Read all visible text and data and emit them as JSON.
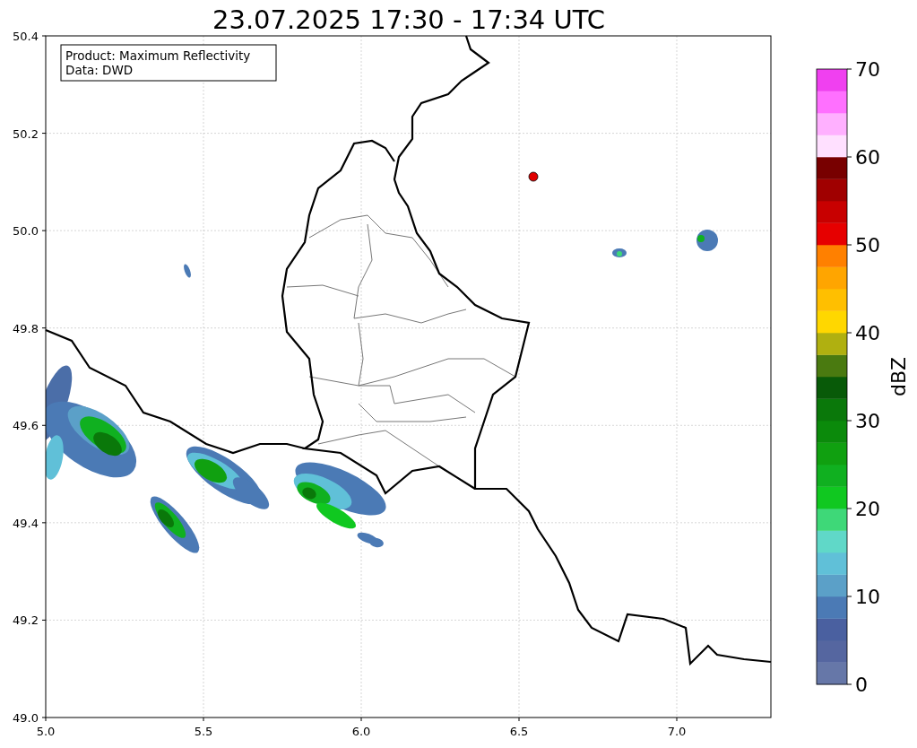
{
  "title": "23.07.2025 17:30 - 17:34 UTC",
  "info_box": {
    "lines": [
      "Product: Maximum Reflectivity",
      "Data: DWD"
    ]
  },
  "map": {
    "x_ticks": [
      "5.0",
      "5.5",
      "6.0",
      "6.5",
      "7.0"
    ],
    "y_ticks": [
      "50.4",
      "50.2",
      "50.0",
      "49.8",
      "49.6",
      "49.4",
      "49.2",
      "49.0"
    ]
  },
  "colorbar": {
    "label": "dBZ",
    "ticks": [
      "70",
      "60",
      "50",
      "40",
      "30",
      "20",
      "10",
      "0"
    ],
    "segments": [
      {
        "color": "#6677a8"
      },
      {
        "color": "#5566a0"
      },
      {
        "color": "#4a60a0"
      },
      {
        "color": "#4b7ab5"
      },
      {
        "color": "#5ba0c8"
      },
      {
        "color": "#60c0d8"
      },
      {
        "color": "#60d8c8"
      },
      {
        "color": "#3ed878"
      },
      {
        "color": "#10c820"
      },
      {
        "color": "#10b020"
      },
      {
        "color": "#10a010"
      },
      {
        "color": "#0b8a0b"
      },
      {
        "color": "#0a780a"
      },
      {
        "color": "#085a08"
      },
      {
        "color": "#4a7a10"
      },
      {
        "color": "#b0b010"
      },
      {
        "color": "#ffd700"
      },
      {
        "color": "#ffbf00"
      },
      {
        "color": "#ffa500"
      },
      {
        "color": "#ff8000"
      },
      {
        "color": "#e60000"
      },
      {
        "color": "#c80000"
      },
      {
        "color": "#a00000"
      },
      {
        "color": "#780000"
      },
      {
        "color": "#ffe0ff"
      },
      {
        "color": "#ffb0ff"
      },
      {
        "color": "#ff70ff"
      },
      {
        "color": "#f040f0"
      }
    ]
  }
}
